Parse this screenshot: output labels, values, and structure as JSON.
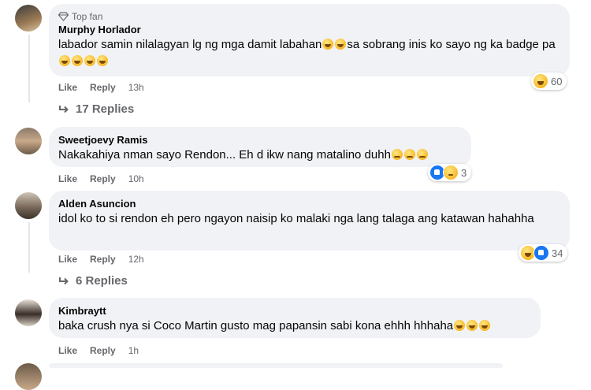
{
  "comments": [
    {
      "badge": "Top fan",
      "author": "Murphy Horlador",
      "text": "labador samin nilalagyan lg ng mga damit labahan",
      "text2": "sa sobrang inis ko sayo ng ka badge pa",
      "like": "Like",
      "reply": "Reply",
      "time": "13h",
      "reaction_count": "60",
      "replies": "17 Replies"
    },
    {
      "author": "Sweetjoevy Ramis",
      "text": "Nakakahiya nman sayo Rendon... Eh d ikw nang matalino duhh",
      "like": "Like",
      "reply": "Reply",
      "time": "10h",
      "reaction_count": "3"
    },
    {
      "author": "Alden Asuncion",
      "text": "idol ko to si rendon eh pero ngayon naisip ko malaki nga lang talaga ang katawan hahahha",
      "like": "Like",
      "reply": "Reply",
      "time": "12h",
      "reaction_count": "34",
      "replies": "6 Replies"
    },
    {
      "author": "Kimbraytt",
      "text": "baka crush nya si Coco Martin gusto mag papansin sabi kona ehhh hhhaha",
      "like": "Like",
      "reply": "Reply",
      "time": "1h"
    }
  ],
  "colors": {
    "bubble": "#f0f2f5",
    "meta": "#65676b",
    "like_blue": "#1877f2",
    "haha_yellow": "#f7b928"
  },
  "icons": [
    "diamond-icon",
    "haha-emoji-icon",
    "sad-emoji-icon",
    "like-reaction-icon",
    "reply-arrow-icon"
  ]
}
